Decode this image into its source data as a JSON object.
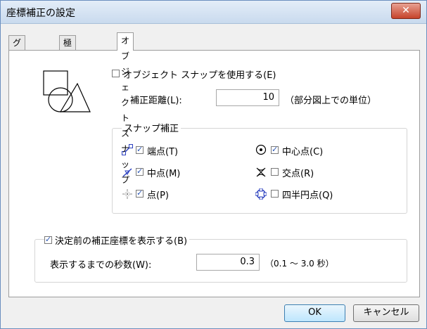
{
  "window": {
    "title": "座標補正の設定",
    "close_glyph": "✕"
  },
  "tabs": [
    {
      "label": "グリッド"
    },
    {
      "label": "極スナップ"
    },
    {
      "label": "オブジェクト スナップ"
    }
  ],
  "object_snap": {
    "enable_label": "オブジェクト スナップを使用する(E)",
    "enable_checked": false,
    "distance_label": "補正距離(L):",
    "distance_value": "10",
    "distance_unit": "（部分図上での単位）"
  },
  "snap_group": {
    "title": "スナップ補正",
    "items": [
      {
        "label": "端点(T)",
        "checked": true,
        "icon": "endpoint-icon"
      },
      {
        "label": "中心点(C)",
        "checked": true,
        "icon": "center-icon"
      },
      {
        "label": "中点(M)",
        "checked": true,
        "icon": "midpoint-icon"
      },
      {
        "label": "交点(R)",
        "checked": false,
        "icon": "intersection-icon"
      },
      {
        "label": "点(P)",
        "checked": true,
        "icon": "node-icon"
      },
      {
        "label": "四半円点(Q)",
        "checked": false,
        "icon": "quadrant-icon"
      }
    ]
  },
  "preview_group": {
    "title": "決定前の補正座標を表示する(B)",
    "checked": true,
    "seconds_label": "表示するまでの秒数(W):",
    "seconds_value": "0.3",
    "seconds_range": "（0.1 〜 3.0 秒）"
  },
  "buttons": {
    "ok": "OK",
    "cancel": "キャンセル"
  },
  "colors": {
    "close": "#c6432b",
    "check": "#2a55b5",
    "icon_blue": "#2a3fbf"
  }
}
